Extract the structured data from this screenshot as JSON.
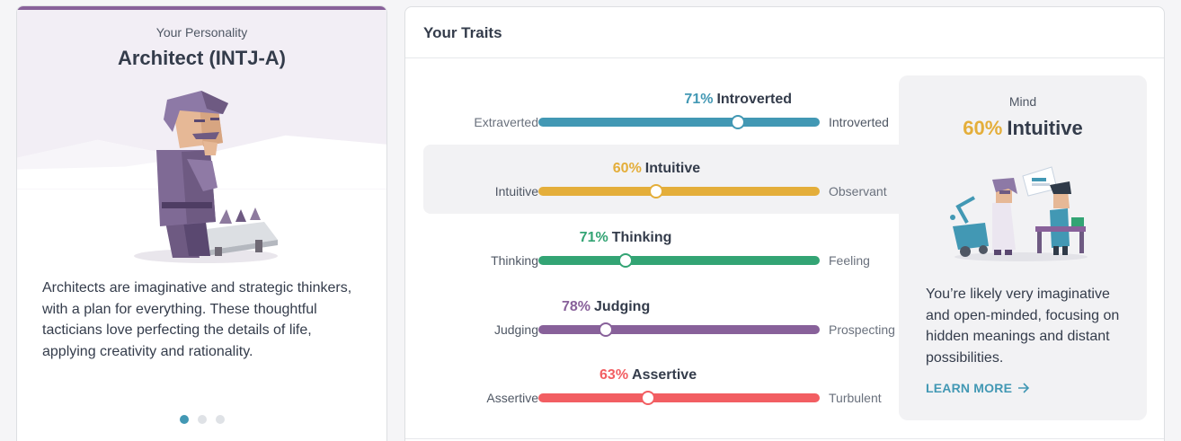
{
  "personality": {
    "kicker": "Your Personality",
    "type_name": "Architect (INTJ-A)",
    "description": "Architects are imaginative and strategic thinkers, with a plan for everything. These thoughtful tacticians love perfecting the details of life, applying creativity and rationality.",
    "carousel_active_index": 0,
    "carousel_count": 3,
    "accent_color": "#88619a"
  },
  "traits": {
    "title": "Your Traits",
    "rows": [
      {
        "percent": "71%",
        "label": "Introverted",
        "left": "Extraverted",
        "right": "Introverted",
        "color": "#4298b4",
        "position": 0.71
      },
      {
        "percent": "60%",
        "label": "Intuitive",
        "left": "Intuitive",
        "right": "Observant",
        "color": "#e4ae3a",
        "position": 0.42
      },
      {
        "percent": "71%",
        "label": "Thinking",
        "left": "Thinking",
        "right": "Feeling",
        "color": "#33a474",
        "position": 0.31
      },
      {
        "percent": "78%",
        "label": "Judging",
        "left": "Judging",
        "right": "Prospecting",
        "color": "#88619a",
        "position": 0.24
      },
      {
        "percent": "63%",
        "label": "Assertive",
        "left": "Assertive",
        "right": "Turbulent",
        "color": "#f25e62",
        "position": 0.39
      }
    ],
    "selected_index": 1
  },
  "detail": {
    "kicker": "Mind",
    "percent": "60%",
    "label": "Intuitive",
    "color": "#e4ae3a",
    "text": "You’re likely very imaginative and open-minded, focusing on hidden meanings and distant possibilities.",
    "learn_more": "LEARN MORE"
  }
}
